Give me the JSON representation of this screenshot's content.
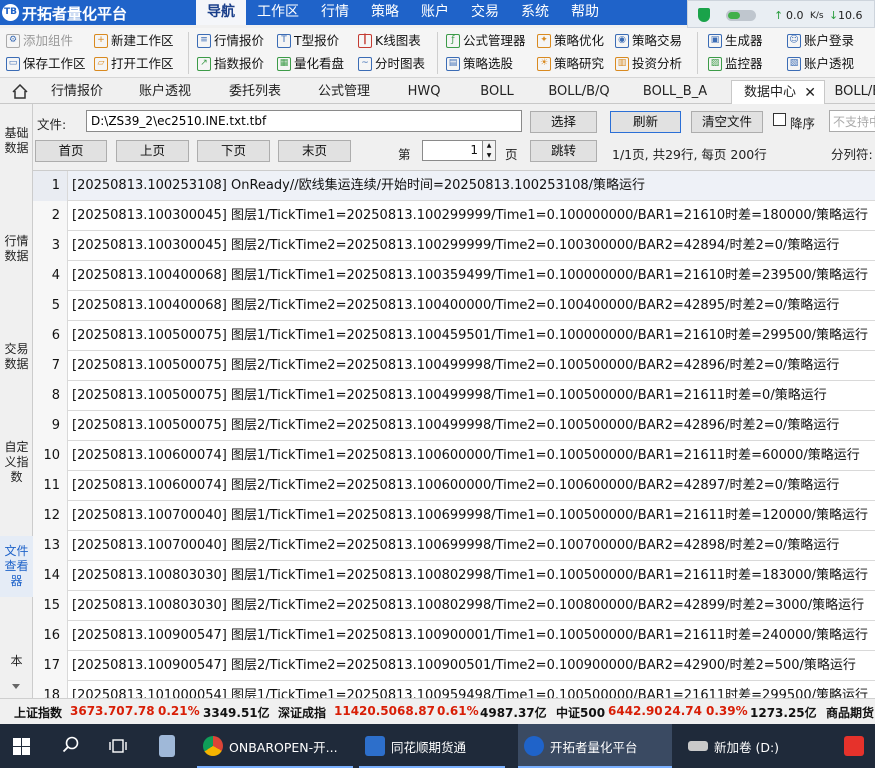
{
  "app": {
    "title": "开拓者量化平台"
  },
  "menus": [
    "导航",
    "工作区",
    "行情",
    "策略",
    "账户",
    "交易",
    "系统",
    "帮助"
  ],
  "network": {
    "up": "0.0",
    "down": "10.6",
    "unit": "K/s"
  },
  "toolbar": {
    "add_component": "添加组件",
    "new_workspace": "新建工作区",
    "save_workspace": "保存工作区",
    "open_workspace": "打开工作区",
    "quote_price": "行情报价",
    "index_price": "指数报价",
    "t_price": "T型报价",
    "volume_board": "量化看盘",
    "kline": "K线图表",
    "tick_chart": "分时图表",
    "formula_manager": "公式管理器",
    "strategy_select": "策略选股",
    "strategy_optimize": "策略优化",
    "strategy_research": "策略研究",
    "strategy_trade": "策略交易",
    "investment_analysis": "投资分析",
    "generator": "生成器",
    "monitor": "监控器",
    "account_login": "账户登录",
    "account_view": "账户透视"
  },
  "tabs": [
    "行情报价",
    "账户透视",
    "委托列表",
    "公式管理",
    "HWQ",
    "BOLL",
    "BOLL/B/Q",
    "BOLL_B_A",
    "数据中心",
    "BOLL/B/"
  ],
  "sidebar": {
    "basic": "基础数据",
    "quote": "行情数据",
    "trade": "交易数据",
    "custom": "自定义指数",
    "file": "文件查看器",
    "local": "本"
  },
  "file_bar": {
    "label": "文件:",
    "path": "D:\\ZS39_2\\ec2510.INE.txt.tbf",
    "select": "选择",
    "refresh": "刷新",
    "clear": "清空文件",
    "desc": "降序",
    "unsupported": "不支持中"
  },
  "pager": {
    "first": "首页",
    "prev": "上页",
    "next": "下页",
    "last": "末页",
    "page_label": "第",
    "page_value": "1",
    "page_unit": "页",
    "jump": "跳转",
    "info": "1/1页, 共29行, 每页 200行",
    "separator": "分列符:"
  },
  "rows": [
    {
      "n": "1",
      "text": "[20250813.100253108] OnReady//欧线集运连续/开始时间=20250813.100253108/策略运行"
    },
    {
      "n": "2",
      "text": "[20250813.100300045] 图层1/TickTime1=20250813.100299999/Time1=0.100000000/BAR1=21610时差=180000/策略运行"
    },
    {
      "n": "3",
      "text": "[20250813.100300045] 图层2/TickTime2=20250813.100299999/Time2=0.100300000/BAR2=42894/时差2=0/策略运行"
    },
    {
      "n": "4",
      "text": "[20250813.100400068] 图层1/TickTime1=20250813.100359499/Time1=0.100000000/BAR1=21610时差=239500/策略运行"
    },
    {
      "n": "5",
      "text": "[20250813.100400068] 图层2/TickTime2=20250813.100400000/Time2=0.100400000/BAR2=42895/时差2=0/策略运行"
    },
    {
      "n": "6",
      "text": "[20250813.100500075] 图层1/TickTime1=20250813.100459501/Time1=0.100000000/BAR1=21610时差=299500/策略运行"
    },
    {
      "n": "7",
      "text": "[20250813.100500075] 图层2/TickTime2=20250813.100499998/Time2=0.100500000/BAR2=42896/时差2=0/策略运行"
    },
    {
      "n": "8",
      "text": "[20250813.100500075] 图层1/TickTime1=20250813.100499998/Time1=0.100500000/BAR1=21611时差=0/策略运行"
    },
    {
      "n": "9",
      "text": "[20250813.100500075] 图层2/TickTime2=20250813.100499998/Time2=0.100500000/BAR2=42896/时差2=0/策略运行"
    },
    {
      "n": "10",
      "text": "[20250813.100600074] 图层1/TickTime1=20250813.100600000/Time1=0.100500000/BAR1=21611时差=60000/策略运行"
    },
    {
      "n": "11",
      "text": "[20250813.100600074] 图层2/TickTime2=20250813.100600000/Time2=0.100600000/BAR2=42897/时差2=0/策略运行"
    },
    {
      "n": "12",
      "text": "[20250813.100700040] 图层1/TickTime1=20250813.100699998/Time1=0.100500000/BAR1=21611时差=120000/策略运行"
    },
    {
      "n": "13",
      "text": "[20250813.100700040] 图层2/TickTime2=20250813.100699998/Time2=0.100700000/BAR2=42898/时差2=0/策略运行"
    },
    {
      "n": "14",
      "text": "[20250813.100803030] 图层1/TickTime1=20250813.100802998/Time1=0.100500000/BAR1=21611时差=183000/策略运行"
    },
    {
      "n": "15",
      "text": "[20250813.100803030] 图层2/TickTime2=20250813.100802998/Time2=0.100800000/BAR2=42899/时差2=3000/策略运行"
    },
    {
      "n": "16",
      "text": "[20250813.100900547] 图层1/TickTime1=20250813.100900001/Time1=0.100500000/BAR1=21611时差=240000/策略运行"
    },
    {
      "n": "17",
      "text": "[20250813.100900547] 图层2/TickTime2=20250813.100900501/Time2=0.100900000/BAR2=42900/时差2=500/策略运行"
    },
    {
      "n": "18",
      "text": "[20250813.101000054] 图层1/TickTime1=20250813.100959498/Time1=0.100500000/BAR1=21611时差=299500/策略运行"
    }
  ],
  "status": {
    "sh_label": "上证指数",
    "sh_val": "3673.70",
    "sh_chg": "7.78",
    "sh_pct": "0.21%",
    "sh_amt": "3349.51亿",
    "sz_label": "深证成指",
    "sz_val": "11420.50",
    "sz_chg": "68.87",
    "sz_pct": "0.61%",
    "sz_amt": "4987.37亿",
    "zz_label": "中证500",
    "zz_val": "6442.90",
    "zz_chg": "24.74",
    "zz_pct": "0.39%",
    "zz_amt": "1273.25亿",
    "more": "商品期货"
  },
  "taskbar": {
    "chrome": "ONBAROPEN-开...",
    "ths": "同花顺期货通",
    "tbq": "开拓者量化平台",
    "drive": "新加卷 (D:)"
  },
  "colors": {
    "title_blue": "#1f63c9",
    "up_red": "#d81e06",
    "taskbar": "#1f2a3a"
  }
}
